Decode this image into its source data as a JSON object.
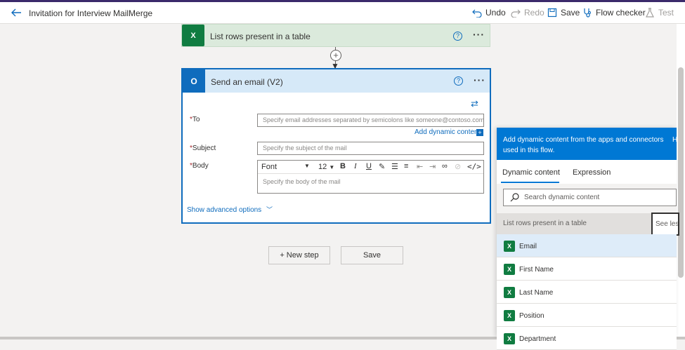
{
  "header": {
    "title": "Invitation for Interview MailMerge",
    "undo": "Undo",
    "redo": "Redo",
    "save": "Save",
    "flow_checker": "Flow checker",
    "test": "Test"
  },
  "step_list_rows": {
    "title": "List rows present in a table",
    "icon_letter": "X",
    "help": "?",
    "more": "···"
  },
  "step_email": {
    "title": "Send an email (V2)",
    "icon_letter": "O",
    "help": "?",
    "more": "···",
    "to_label": "To",
    "to_placeholder": "Specify email addresses separated by semicolons like someone@contoso.com",
    "add_dynamic": "Add dynamic content",
    "subject_label": "Subject",
    "subject_placeholder": "Specify the subject of the mail",
    "body_label": "Body",
    "font": "Font",
    "font_size": "12",
    "body_placeholder": "Specify the body of the mail",
    "advanced": "Show advanced options",
    "required_mark": "*"
  },
  "actions": {
    "new_step": "+ New step",
    "save": "Save"
  },
  "dynamic_panel": {
    "banner": "Add dynamic content from the apps and connectors used in this flow.",
    "banner_hide": "H",
    "tabs": [
      "Dynamic content",
      "Expression"
    ],
    "search_placeholder": "Search dynamic content",
    "section_title": "List rows present in a table",
    "see_less": "See less",
    "items": [
      "Email",
      "First Name",
      "Last Name",
      "Position",
      "Department"
    ]
  },
  "colors": {
    "accent": "#0f6cbd",
    "excel_green": "#107c41",
    "required_red": "#a4262c"
  }
}
